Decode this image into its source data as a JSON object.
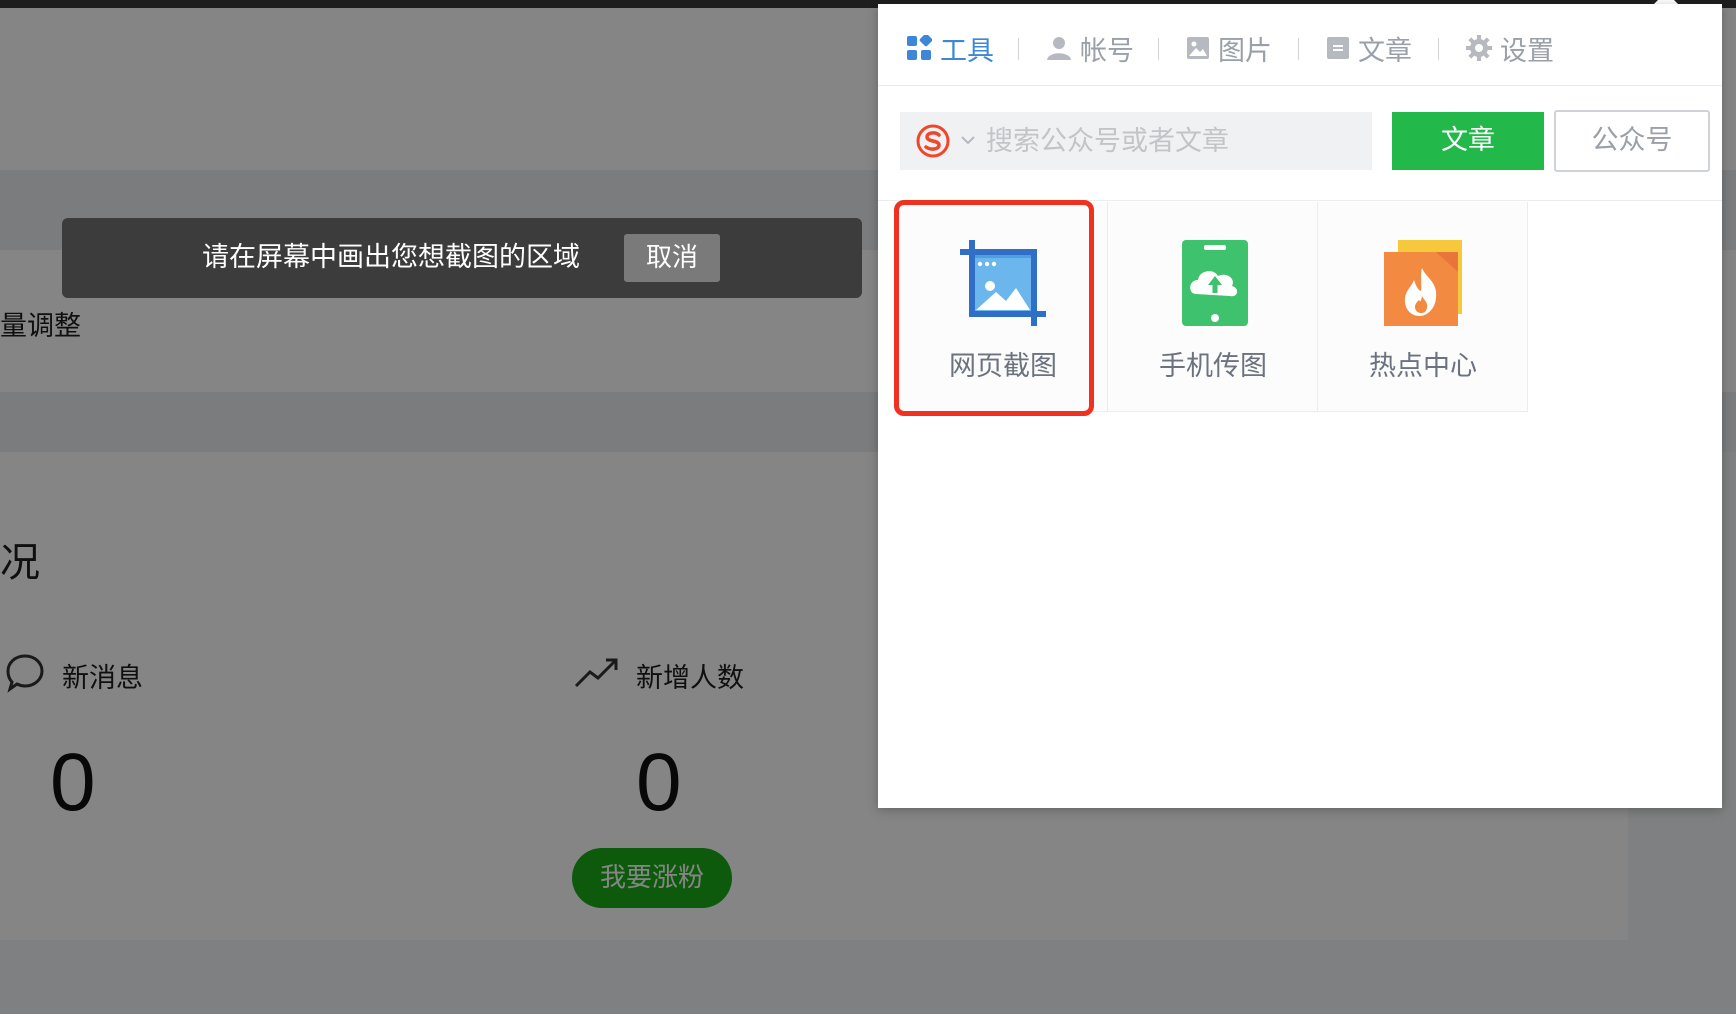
{
  "background": {
    "partial_text_1": "量调整",
    "partial_text_2": "况",
    "stats": [
      {
        "icon": "chat-bubble-icon",
        "label": "新消息",
        "value": "0"
      },
      {
        "icon": "trend-up-icon",
        "label": "新增人数",
        "value": "0"
      }
    ],
    "grow_button": "我要涨粉"
  },
  "capture_bar": {
    "message": "请在屏幕中画出您想截图的区域",
    "cancel_label": "取消"
  },
  "panel": {
    "tabs": [
      {
        "icon": "grid-icon",
        "label": "工具",
        "active": true
      },
      {
        "icon": "user-icon",
        "label": "帐号",
        "active": false
      },
      {
        "icon": "image-icon",
        "label": "图片",
        "active": false
      },
      {
        "icon": "article-icon",
        "label": "文章",
        "active": false
      },
      {
        "icon": "gear-icon",
        "label": "设置",
        "active": false
      }
    ],
    "search": {
      "engine_icon": "sogou-logo-icon",
      "placeholder": "搜索公众号或者文章",
      "value": "",
      "article_button": "文章",
      "account_button": "公众号"
    },
    "tools": [
      {
        "icon": "screenshot-crop-icon",
        "label": "网页截图",
        "highlighted": true
      },
      {
        "icon": "phone-upload-icon",
        "label": "手机传图",
        "highlighted": false
      },
      {
        "icon": "hot-topic-fire-icon",
        "label": "热点中心",
        "highlighted": false
      }
    ]
  },
  "colors": {
    "active_tab": "#3e86d8",
    "article_button": "#22b84a",
    "highlight_border": "#f0311f",
    "grow_button": "#1aad19"
  }
}
